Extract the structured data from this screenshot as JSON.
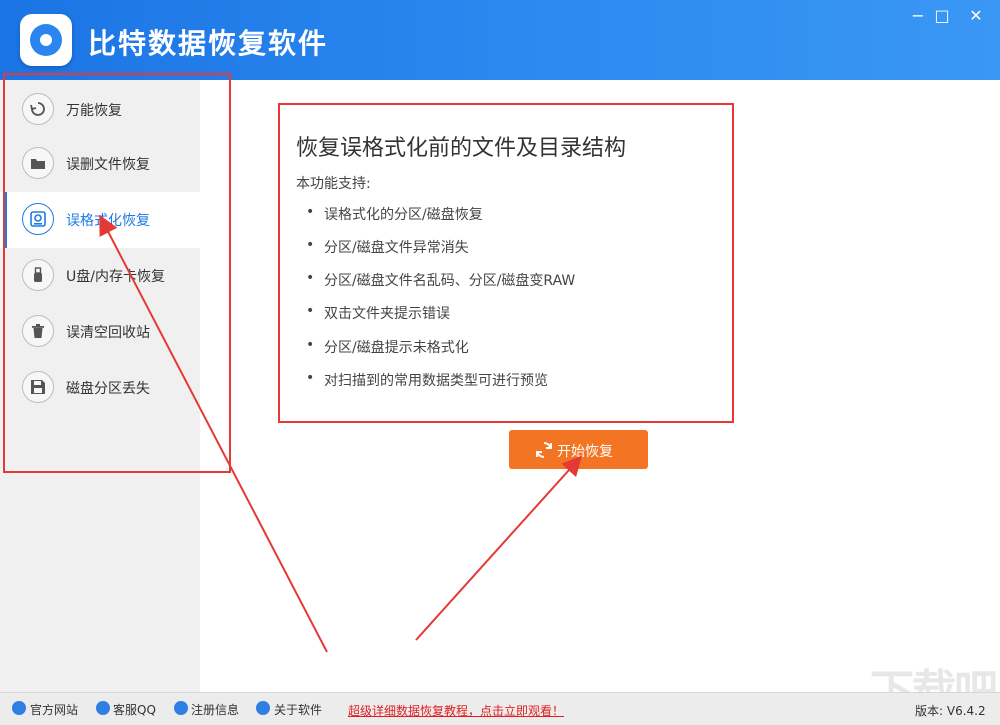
{
  "window": {
    "title": "比特数据恢复软件",
    "controls": {
      "minimize": "−",
      "maximize": "□",
      "close": "✕"
    }
  },
  "sidebar": {
    "items": [
      {
        "label": "万能恢复",
        "icon": "refresh-icon",
        "active": false
      },
      {
        "label": "误删文件恢复",
        "icon": "folder-icon",
        "active": false
      },
      {
        "label": "误格式化恢复",
        "icon": "disk-icon",
        "active": true
      },
      {
        "label": "U盘/内存卡恢复",
        "icon": "usb-icon",
        "active": false
      },
      {
        "label": "误清空回收站",
        "icon": "trash-icon",
        "active": false
      },
      {
        "label": "磁盘分区丢失",
        "icon": "save-icon",
        "active": false
      }
    ]
  },
  "main": {
    "title": "恢复误格式化前的文件及目录结构",
    "subtitle": "本功能支持:",
    "features": [
      "误格式化的分区/磁盘恢复",
      "分区/磁盘文件异常消失",
      "分区/磁盘文件名乱码、分区/磁盘变RAW",
      "双击文件夹提示错误",
      "分区/磁盘提示未格式化",
      "对扫描到的常用数据类型可进行预览"
    ],
    "start_button": "开始恢复"
  },
  "footer": {
    "links": [
      "官方网站",
      "客服QQ",
      "注册信息",
      "关于软件"
    ],
    "promo": "超级详细数据恢复教程，点击立即观看！",
    "version": "版本: V6.4.2"
  },
  "watermark": "下载吧",
  "colors": {
    "accent": "#1e7ae6",
    "start_button": "#f37524",
    "annotation": "#e53935"
  }
}
